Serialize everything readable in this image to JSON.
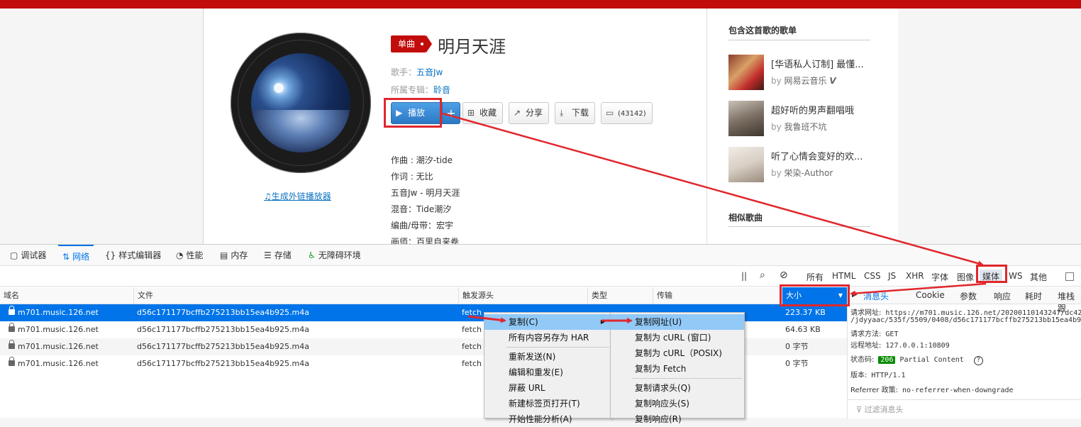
{
  "song": {
    "badge": "单曲",
    "title": "明月天涯",
    "singer_label": "歌手：",
    "singer": "五音Jw",
    "album_label": "所属专辑：",
    "album": "聆音",
    "buttons": {
      "play": "播放",
      "add": "+",
      "collect": "收藏",
      "share": "分享",
      "download": "下载",
      "comment": "(43142)"
    },
    "outlink": "生成外链播放器",
    "lyrics": [
      "作曲 : 潮汐-tide",
      "作词 : 无比",
      "五音Jw - 明月天涯",
      "混音：Tide潮汐",
      "编曲/母带：宏宇",
      "画师：百里自来卷"
    ]
  },
  "sidebar": {
    "title": "包含这首歌的歌单",
    "playlists": [
      {
        "name": "[华语私人订制] 最懂...",
        "by": "by",
        "author": "网易云音乐",
        "verified": "V"
      },
      {
        "name": "超好听的男声翻唱哦",
        "by": "by",
        "author": "我鲁班不坑"
      },
      {
        "name": "听了心情会变好的欢...",
        "by": "by",
        "author": "栄染-Author"
      }
    ],
    "similar_title": "相似歌曲"
  },
  "devtools": {
    "tabs": [
      {
        "icon": "▢",
        "label": "调试器"
      },
      {
        "icon": "⇅",
        "label": "网络"
      },
      {
        "icon": "{}",
        "label": "样式编辑器"
      },
      {
        "icon": "◔",
        "label": "性能"
      },
      {
        "icon": "▤",
        "label": "内存"
      },
      {
        "icon": "☰",
        "label": "存储"
      },
      {
        "icon": "♿",
        "label": "无障碍环境"
      }
    ],
    "filters": [
      "所有",
      "HTML",
      "CSS",
      "JS",
      "XHR",
      "字体",
      "图像",
      "媒体",
      "WS",
      "其他"
    ],
    "pause": "||",
    "columns": [
      "域名",
      "文件",
      "触发源头",
      "类型",
      "传输",
      "大小"
    ],
    "rows": [
      {
        "domain": "m701.music.126.net",
        "file": "d56c171177bcffb275213bb15ea4b925.m4a",
        "cause": "fetch",
        "size": "223.37 KB"
      },
      {
        "domain": "m701.music.126.net",
        "file": "d56c171177bcffb275213bb15ea4b925.m4a",
        "cause": "fetch",
        "size": "64.63 KB"
      },
      {
        "domain": "m701.music.126.net",
        "file": "d56c171177bcffb275213bb15ea4b925.m4a",
        "cause": "fetch",
        "size": "0 字节"
      },
      {
        "domain": "m701.music.126.net",
        "file": "d56c171177bcffb275213bb15ea4b925.m4a",
        "cause": "fetch",
        "size": "0 字节"
      }
    ],
    "detail": {
      "tabs": [
        "消息头",
        "Cookie",
        "参数",
        "响应",
        "耗时",
        "堆栈跟"
      ],
      "request_url_label": "请求网址:",
      "request_url": "https://m701.music.126.net/20200110143247/dc42",
      "request_url_cont": "/jdyyaac/535f/5509/0408/d56c171177bcffb275213bb15ea4b9",
      "method_label": "请求方法:",
      "method": "GET",
      "remote_label": "远程地址:",
      "remote": "127.0.0.1:10809",
      "status_label": "状态码:",
      "status_code": "206",
      "status_text": "Partial Content",
      "version_label": "版本:",
      "version": "HTTP/1.1",
      "referrer_label": "Referrer 政策:",
      "referrer": "no-referrer-when-downgrade",
      "filter_placeholder": "过滤消息头"
    }
  },
  "context_menu": {
    "items": [
      "复制(C)",
      "所有内容另存为 HAR",
      "重新发送(N)",
      "编辑和重发(E)",
      "屏蔽 URL",
      "新建标签页打开(T)",
      "开始性能分析(A)"
    ]
  },
  "submenu": {
    "items": [
      "复制网址(U)",
      "复制为 cURL (窗口)",
      "复制为 cURL（POSIX)",
      "复制为 Fetch",
      "复制请求头(Q)",
      "复制响应头(S)",
      "复制响应(R)"
    ]
  },
  "colors": {
    "brand_red": "#c20c0c",
    "link_blue": "#0c73c2",
    "devtools_blue": "#0074e8",
    "annotation_red": "#e0272d"
  }
}
